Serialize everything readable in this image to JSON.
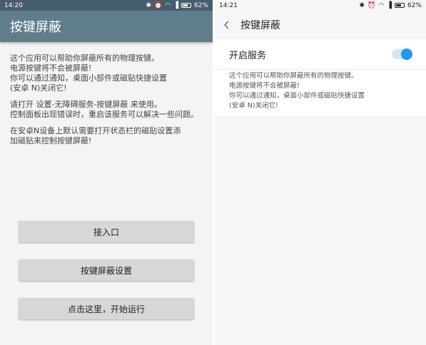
{
  "left": {
    "status": {
      "time": "14:20",
      "battery": "62%"
    },
    "title": "按键屏蔽",
    "paragraphs": [
      "这个应用可以帮助你屏蔽所有的物理按键。\n电源按键将不会被屏蔽!\n你可以通过通知，桌面小部件或磁贴快捷设置\n(安卓 N)关闭它!",
      "请打开 设置-无障碍服务-按键屏蔽 来使用。\n控制面板出现错误时，重启该服务可以解决一些问题。",
      "在安卓N设备上默认需要打开状态栏的磁贴设置添\n加磁贴来控制按键屏蔽!"
    ],
    "buttons": {
      "entry": "接入口",
      "settings": "按键屏蔽设置",
      "start": "点击这里，开始运行"
    }
  },
  "right": {
    "status": {
      "time": "14:21",
      "battery": "62%"
    },
    "title": "按键屏蔽",
    "switch_label": "开启服务",
    "switch_on": true,
    "description": "这个应用可以帮助你屏蔽所有的物理按键。\n电源按键将不会被屏蔽!\n你可以通过通知，桌面小部件或磁贴快捷设置\n(安卓 N)关闭它!"
  },
  "colors": {
    "left_appbar": "#607d8b",
    "left_statusbar": "#465d6c",
    "toggle_accent": "#2196f3"
  },
  "icons": [
    "bluetooth-icon",
    "alarm-icon",
    "wifi-icon",
    "signal-icon",
    "battery-icon",
    "back-arrow-icon"
  ]
}
